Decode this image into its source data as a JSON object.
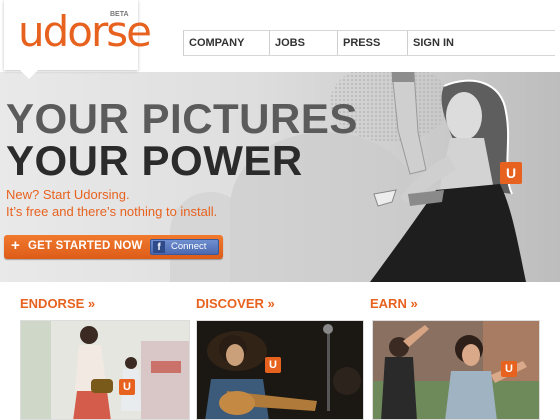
{
  "header": {
    "logo": "udorse",
    "logo_badge": "BETA",
    "nav": [
      "COMPANY",
      "JOBS",
      "PRESS",
      "SIGN IN"
    ]
  },
  "hero": {
    "headline_line1": "YOUR PICTURES",
    "headline_line2": "YOUR POWER",
    "subtext_line1": "New? Start Udorsing.",
    "subtext_line2": "It’s free and there’s nothing to install.",
    "cta_plus": "+",
    "cta_label": "GET STARTED NOW",
    "facebook_icon": "f",
    "facebook_label": "Connect",
    "badge": "U"
  },
  "sections": [
    {
      "title": "ENDORSE »",
      "badge": "U"
    },
    {
      "title": "DISCOVER »",
      "badge": "U"
    },
    {
      "title": "EARN »",
      "badge": "U"
    }
  ],
  "colors": {
    "accent": "#e8621f",
    "facebook": "#3b5998"
  }
}
